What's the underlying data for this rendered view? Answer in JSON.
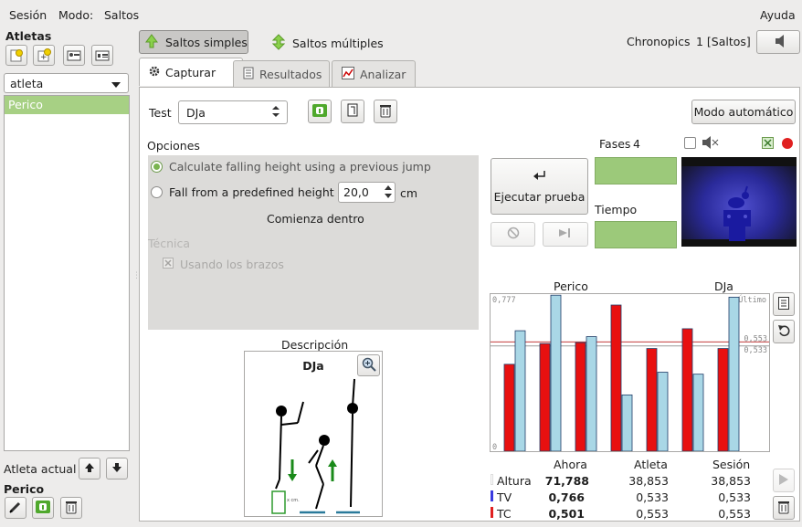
{
  "menu": {
    "session": "Sesión",
    "mode": "Modo:",
    "jumps": "Saltos",
    "help": "Ayuda"
  },
  "title_partial": "",
  "athletes": {
    "header": "Atletas",
    "filter_value": "atleta",
    "list": [
      "Perico"
    ],
    "current_label": "Atleta actual",
    "current_name": "Perico"
  },
  "jump_modes": {
    "simple": "Saltos simples",
    "multiple": "Saltos múltiples"
  },
  "chronopics": {
    "label": "Chronopics",
    "status": "1 [Saltos]"
  },
  "tabs": [
    "Capturar",
    "Resultados",
    "Analizar"
  ],
  "test": {
    "label": "Test",
    "value": "DJa"
  },
  "auto_mode_button": "Modo automático",
  "options": {
    "header": "Opciones",
    "radio1": "Calculate falling height using a previous jump",
    "radio2": "Fall from a predefined height",
    "height_value": "20,0",
    "height_unit": "cm",
    "start_inside": "Comienza dentro",
    "technique": "Técnica",
    "arms": "Usando los brazos"
  },
  "description": {
    "label": "Descripción",
    "title": "DJa",
    "figure_note": "x cm."
  },
  "execute": {
    "button": "Ejecutar prueba",
    "phases_label": "Fases",
    "phases_value": "4",
    "time_label": "Tiempo"
  },
  "chart_data": {
    "type": "bar",
    "title_left": "Perico",
    "title_right": "DJa",
    "ylim": [
      0,
      0.777
    ],
    "top_label": "0,777",
    "zero_label": "0",
    "last_label": "Último",
    "ref_labels": [
      "0,553",
      "0,533"
    ],
    "ref_values": [
      0.553,
      0.533
    ],
    "ref_colors": [
      "#c23b3b",
      "#9a9a9a"
    ],
    "series": [
      {
        "color": "#e81010",
        "values": [
          0.44,
          0.545,
          0.55,
          0.74,
          0.52,
          0.62,
          0.52
        ]
      },
      {
        "color": "#a9d7e6",
        "values": [
          0.61,
          0.79,
          0.58,
          0.285,
          0.4,
          0.39,
          0.78
        ]
      }
    ]
  },
  "stats": {
    "headers": [
      "Ahora",
      "Atleta",
      "Sesión"
    ],
    "rows": [
      {
        "label": "Altura",
        "values": [
          "71,788",
          "38,853",
          "38,853"
        ],
        "color": "#ffffff"
      },
      {
        "label": "TV",
        "values": [
          "0,766",
          "0,533",
          "0,533"
        ],
        "color": "#3a3ae0"
      },
      {
        "label": "TC",
        "values": [
          "0,501",
          "0,553",
          "0,553"
        ],
        "color": "#e02020"
      }
    ]
  }
}
